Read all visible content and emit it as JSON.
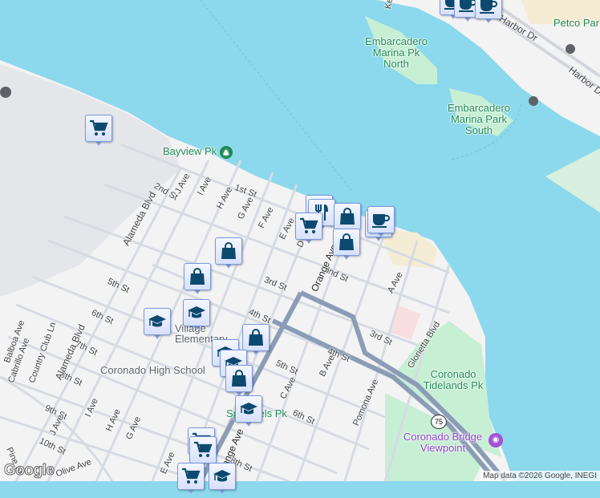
{
  "map": {
    "colors": {
      "water": "#8cd8ec",
      "land": "#f4f3f4",
      "park": "#c6efd4",
      "base": "#e8e9ec",
      "marker_icon": "#0b4a6e",
      "road_major": "#8b9db6"
    },
    "street_labels": [
      "1st St",
      "2nd St",
      "2nd St",
      "3rd St",
      "3rd St",
      "4th St",
      "4th St",
      "5th St",
      "5th St",
      "6th St",
      "6th St",
      "7th St",
      "8th St",
      "8th St",
      "9th St",
      "10th St",
      "J Ave",
      "I Ave",
      "H Ave",
      "G Ave",
      "F Ave",
      "E Ave",
      "D Ave",
      "Orange Ave",
      "Orange Ave",
      "A Ave",
      "B Ave",
      "C Ave",
      "Pomona Ave",
      "Glorietta Blvd",
      "Alameda Blvd",
      "Alameda Blvd",
      "Balboa Ave",
      "Cabrillo Ave",
      "Country Club Ln",
      "J Ave",
      "I Ave",
      "H Ave",
      "G Ave",
      "E Ave",
      "Olive Ave",
      "Pine St",
      "Harbor Dr",
      "Harbor Dr",
      "Ke"
    ],
    "place_labels": {
      "bayview": "Bayview Pk",
      "emb_north": "Embarcadero Marina Pk North",
      "emb_south": "Embarcadero Marina Park South",
      "petco": "Petco Par",
      "village": "Village Elementary",
      "high_school": "Coronado High School",
      "spreckels": "Spreckels Pk",
      "tidelands": "Coronado Tidelands Pk",
      "viewpoint": "Coronado Bridge Viewpoint",
      "route": "75"
    },
    "markers": [
      "shopping-cart",
      "shopping-bag",
      "shopping-bag",
      "school",
      "school",
      "shopping-bag",
      "school",
      "school",
      "shopping-bag",
      "school",
      "shopping-cart",
      "shopping-cart",
      "shopping-cart",
      "school",
      "restaurant",
      "restaurant",
      "shopping-cart",
      "shopping-bag",
      "restaurant",
      "cafe",
      "shopping-bag",
      "cafe",
      "cafe",
      "cafe"
    ],
    "attribution": "Map data ©2026 Google, INEGI",
    "logo": "Google"
  }
}
